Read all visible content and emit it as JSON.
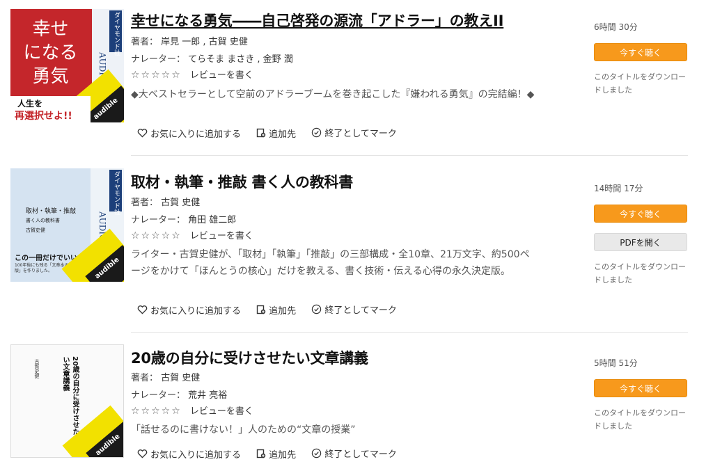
{
  "labels": {
    "author": "著者：",
    "narrator": "ナレーター：",
    "write_review": "レビューを書く",
    "add_favorite": "お気に入りに追加する",
    "add_to": "追加先",
    "mark_finished": "終了としてマーク",
    "listen_now": "今すぐ聴く",
    "open_pdf": "PDFを開く",
    "downloaded": "このタイトルをダウンロードしました"
  },
  "books": [
    {
      "title": "幸せになる勇気――自己啓発の源流「アドラー」の教えII",
      "authors": "岸見 一郎 , 古賀 史健",
      "narrators": "てらそま まさき , 金野 潤",
      "stars": "☆☆☆☆☆",
      "description": "◆大ベストセラーとして空前のアドラーブームを巻き起こした『嫌われる勇気』の完結編！◆",
      "length": "6時間 30分",
      "has_pdf": false
    },
    {
      "title": "取材・執筆・推敲 書く人の教科書",
      "authors": "古賀 史健",
      "narrators": "角田 雄二郎",
      "stars": "☆☆☆☆☆",
      "description": "ライター・古賀史健が、「取材」「執筆」「推敲」の三部構成・全10章、21万文字、約500ページをかけて「ほんとうの核心」だけを教える、書く技術・伝える心得の永久決定版。",
      "length": "14時間 17分",
      "has_pdf": true
    },
    {
      "title": "20歳の自分に受けさせたい文章講義",
      "authors": "古賀 史健",
      "narrators": "荒井 亮裕",
      "stars": "☆☆☆☆☆",
      "description": "「話せるのに書けない！」人のための“文章の授業”",
      "length": "5時間 51分",
      "has_pdf": false
    }
  ],
  "covers": {
    "c1_title_lines": [
      "幸せ",
      "になる",
      "勇気"
    ],
    "c1_banner_top": "人生を",
    "c1_banner_bottom": "再選択せよ!!",
    "c2_title": "取材・執筆・推敲",
    "c2_subtitle": "書く人の教科書",
    "c2_author": "古賀史健",
    "c2_tagline": "この一冊だけでいい。",
    "c2_note": "100年後にも残る「文章本の決定版」を作りました。",
    "c3_title": "20歳の自分に受けさせたい文章講義",
    "c3_author": "古賀史健",
    "publisher": "ダイヤモンド社",
    "series": "AUDIO BOOK",
    "only_from": "ONLY FROM",
    "brand": "audible"
  },
  "colors": {
    "accent": "#f7991c",
    "cover1_red": "#c4262b",
    "audible_yellow": "#f2e100"
  }
}
